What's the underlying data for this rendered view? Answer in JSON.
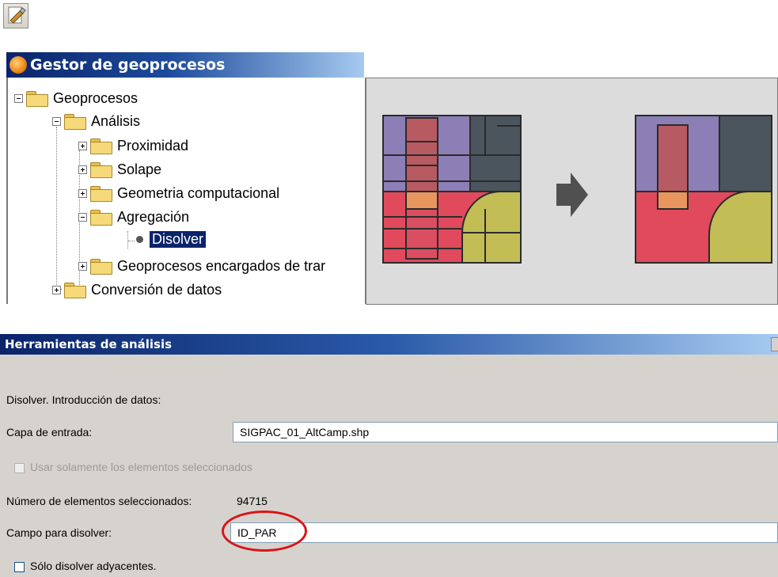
{
  "toolbar": {
    "icon": "geoprocess-tool-icon"
  },
  "gestor": {
    "title": "Gestor de geoprocesos",
    "tree": {
      "geoprocesos": "Geoprocesos",
      "analisis": "Análisis",
      "proximidad": "Proximidad",
      "solape": "Solape",
      "geometria": "Geometria computacional",
      "agregacion": "Agregación",
      "disolver": "Disolver",
      "encargados": "Geoprocesos encargados de trar",
      "conversion": "Conversión de datos"
    }
  },
  "illustration": {
    "colors": {
      "purple": "#8b7fb5",
      "slate": "#4a555d",
      "pink": "#e04a5c",
      "olive": "#c2bd55",
      "orange": "#e8955e",
      "background": "#dcdcdc",
      "arrow": "#505050"
    }
  },
  "dialog": {
    "title": "Herramientas de análisis",
    "heading": "Disolver. Introducción de datos:",
    "input_layer_label": "Capa de entrada:",
    "input_layer_value": "SIGPAC_01_AltCamp.shp",
    "only_selected_label": "Usar solamente los elementos seleccionados",
    "selected_count_label": "Número de elementos seleccionados:",
    "selected_count_value": "94715",
    "dissolve_field_label": "Campo para disolver:",
    "dissolve_field_value": "ID_PAR",
    "adjacent_label": "Sólo disolver adyacentes.",
    "highlight_color": "#d8151a"
  }
}
